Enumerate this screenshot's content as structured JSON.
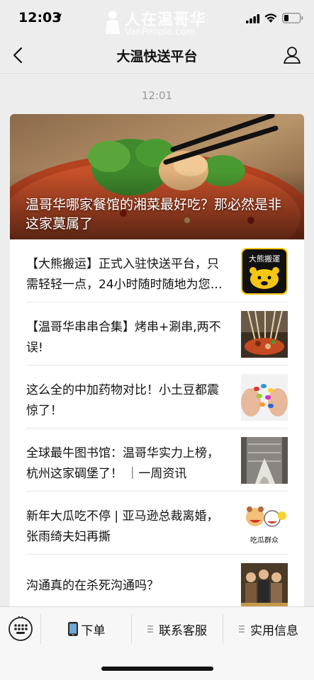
{
  "status_bar": {
    "time": "12:03",
    "watermark_cn": "人在温哥华",
    "watermark_en": "VanPeople.com"
  },
  "nav": {
    "title": "大温快送平台"
  },
  "chat": {
    "timestamp": "12:01"
  },
  "hero": {
    "title": "温哥华哪家餐馆的湘菜最好吃？那必然是非这家莫属了"
  },
  "articles": [
    {
      "title": "【大熊搬运】正式入驻快送平台，只需轻轻一点，24小时随时随地为您服务",
      "thumb_text": "大熊搬運"
    },
    {
      "title": "【温哥华串串合集】烤串+涮串,两不误!"
    },
    {
      "title": "这么全的中加药物对比！小土豆都震惊了！"
    },
    {
      "title": "全球最牛图书馆：温哥华实力上榜，杭州这家碉堡了！ ｜一周资讯"
    },
    {
      "title": "新年大瓜吃不停 | 亚马逊总裁离婚，张雨绮夫妇再撕",
      "thumb_text": "吃瓜群众"
    },
    {
      "title": "沟通真的在杀死沟通吗？"
    }
  ],
  "bottom_menu": {
    "items": [
      {
        "label": "下单",
        "icon": "phone-icon"
      },
      {
        "label": "联系客服",
        "icon": "menu-lines-icon"
      },
      {
        "label": "实用信息",
        "icon": "menu-lines-icon"
      }
    ]
  },
  "colors": {
    "background": "#ededed",
    "card": "#ffffff",
    "timestamp": "#9a9a9a"
  }
}
